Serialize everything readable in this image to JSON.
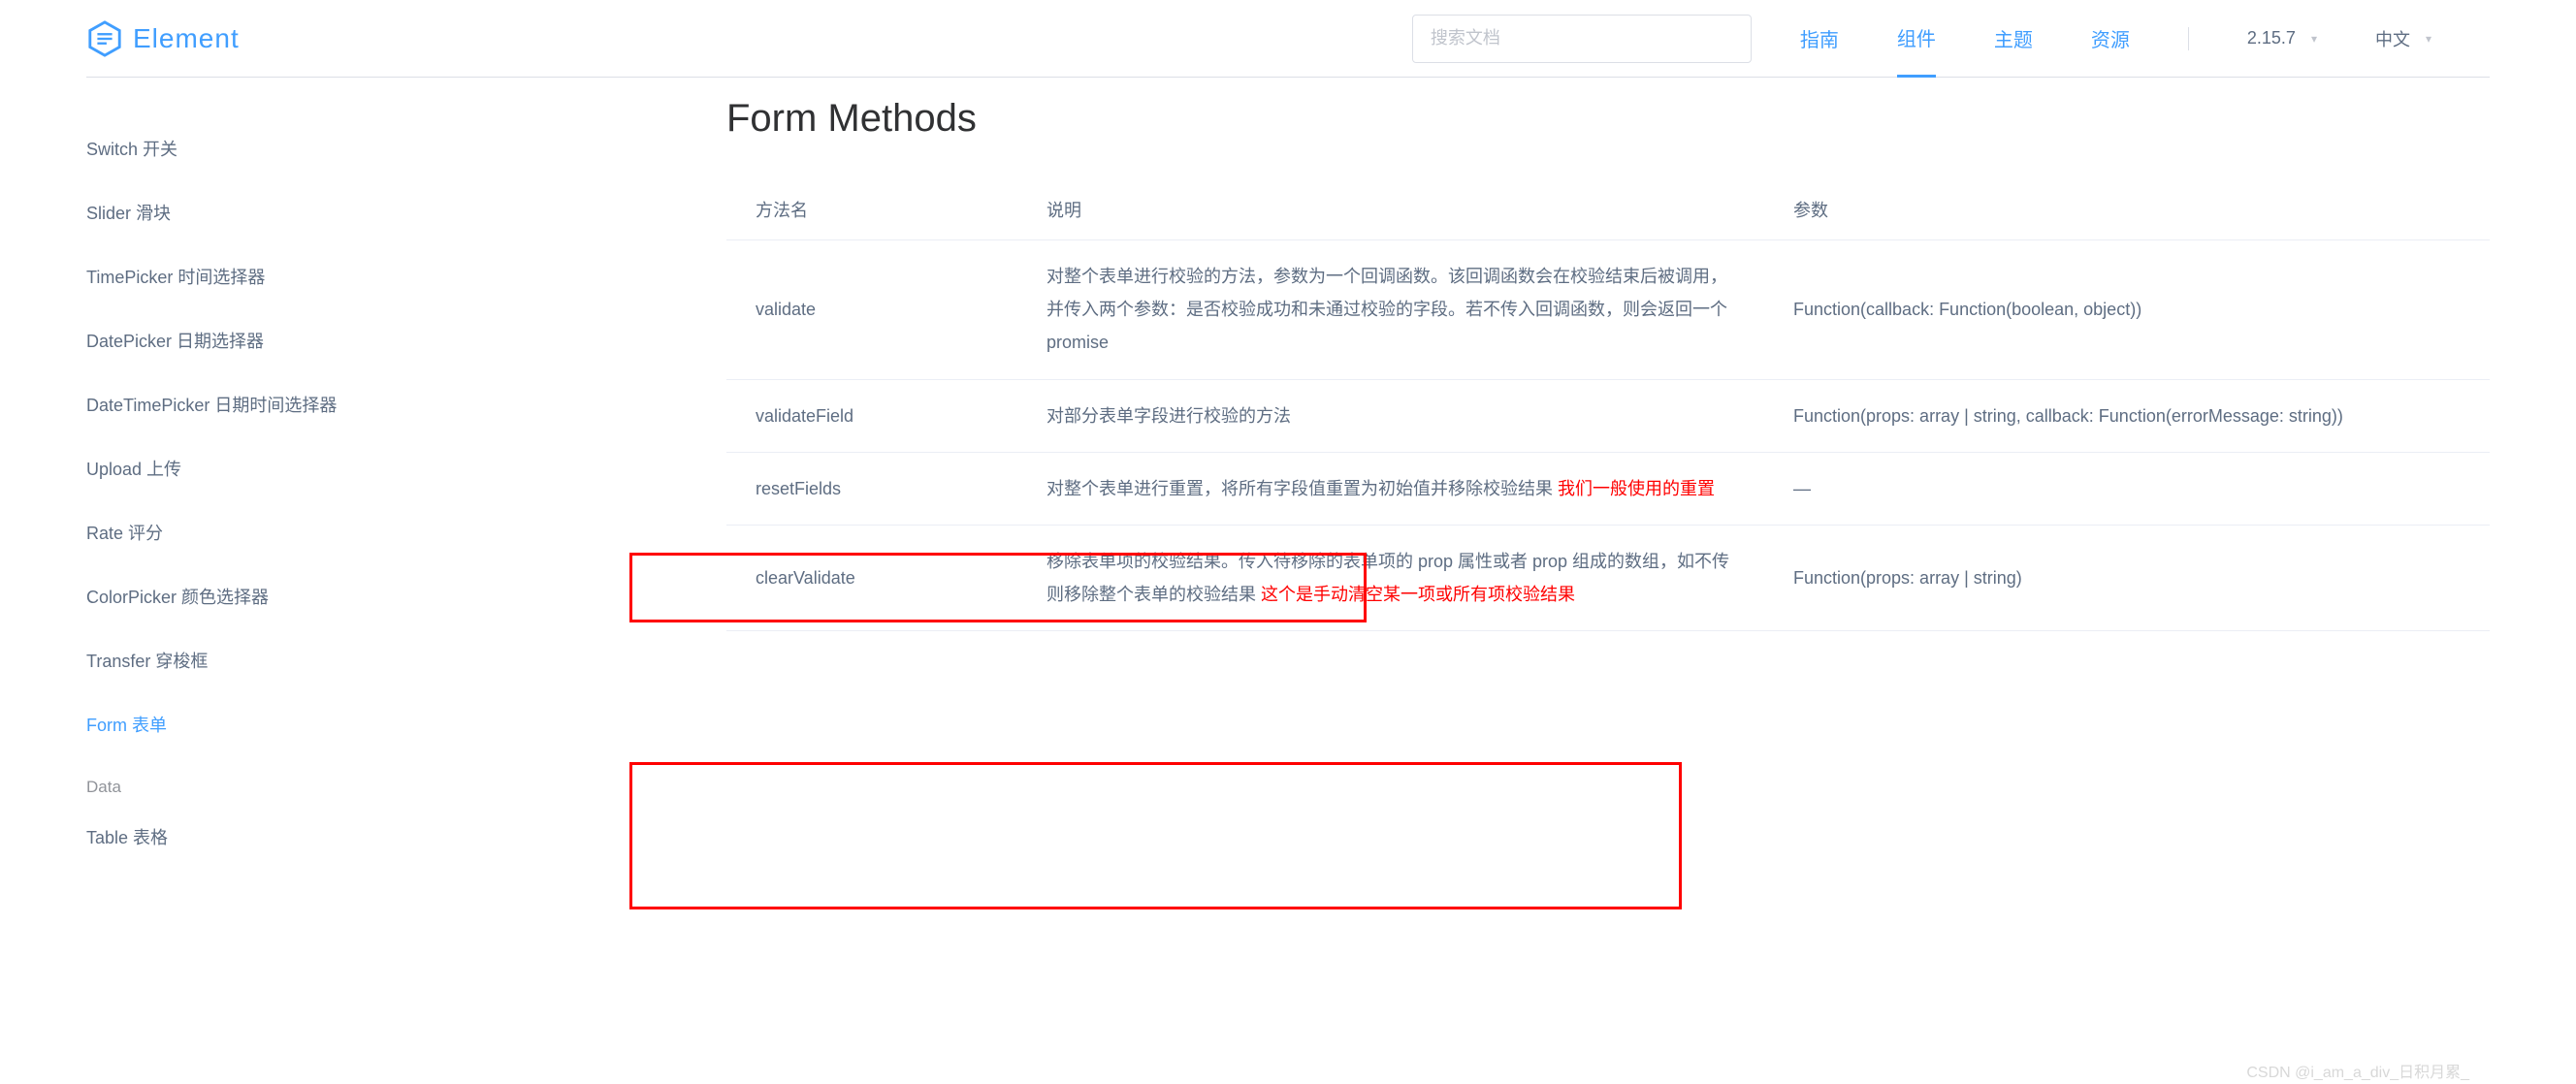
{
  "header": {
    "brand": "Element",
    "search_placeholder": "搜索文档",
    "nav": {
      "guide": "指南",
      "components": "组件",
      "theme": "主题",
      "resources": "资源"
    },
    "version": "2.15.7",
    "lang": "中文"
  },
  "sidebar": {
    "items": [
      "Switch 开关",
      "Slider 滑块",
      "TimePicker 时间选择器",
      "DatePicker 日期选择器",
      "DateTimePicker 日期时间选择器",
      "Upload 上传",
      "Rate 评分",
      "ColorPicker 颜色选择器",
      "Transfer 穿梭框",
      "Form 表单"
    ],
    "group_label": "Data",
    "items_after": [
      "Table 表格"
    ]
  },
  "content": {
    "title": "Form Methods",
    "columns": {
      "c1": "方法名",
      "c2": "说明",
      "c3": "参数"
    },
    "rows": [
      {
        "name": "validate",
        "desc": "对整个表单进行校验的方法，参数为一个回调函数。该回调函数会在校验结束后被调用，并传入两个参数：是否校验成功和未通过校验的字段。若不传入回调函数，则会返回一个 promise",
        "note": "",
        "param": "Function(callback: Function(boolean, object))"
      },
      {
        "name": "validateField",
        "desc": "对部分表单字段进行校验的方法",
        "note": "",
        "param": "Function(props: array | string, callback: Function(errorMessage: string))"
      },
      {
        "name": "resetFields",
        "desc": "对整个表单进行重置，将所有字段值重置为初始值并移除校验结果 ",
        "note": "我们一般使用的重置",
        "param": "—"
      },
      {
        "name": "clearValidate",
        "desc": "移除表单项的校验结果。传入待移除的表单项的 prop 属性或者 prop 组成的数组，如不传则移除整个表单的校验结果   ",
        "note": "这个是手动清空某一项或所有项校验结果",
        "param": "Function(props: array | string)"
      }
    ]
  },
  "watermark": "CSDN @i_am_a_div_日积月累_"
}
